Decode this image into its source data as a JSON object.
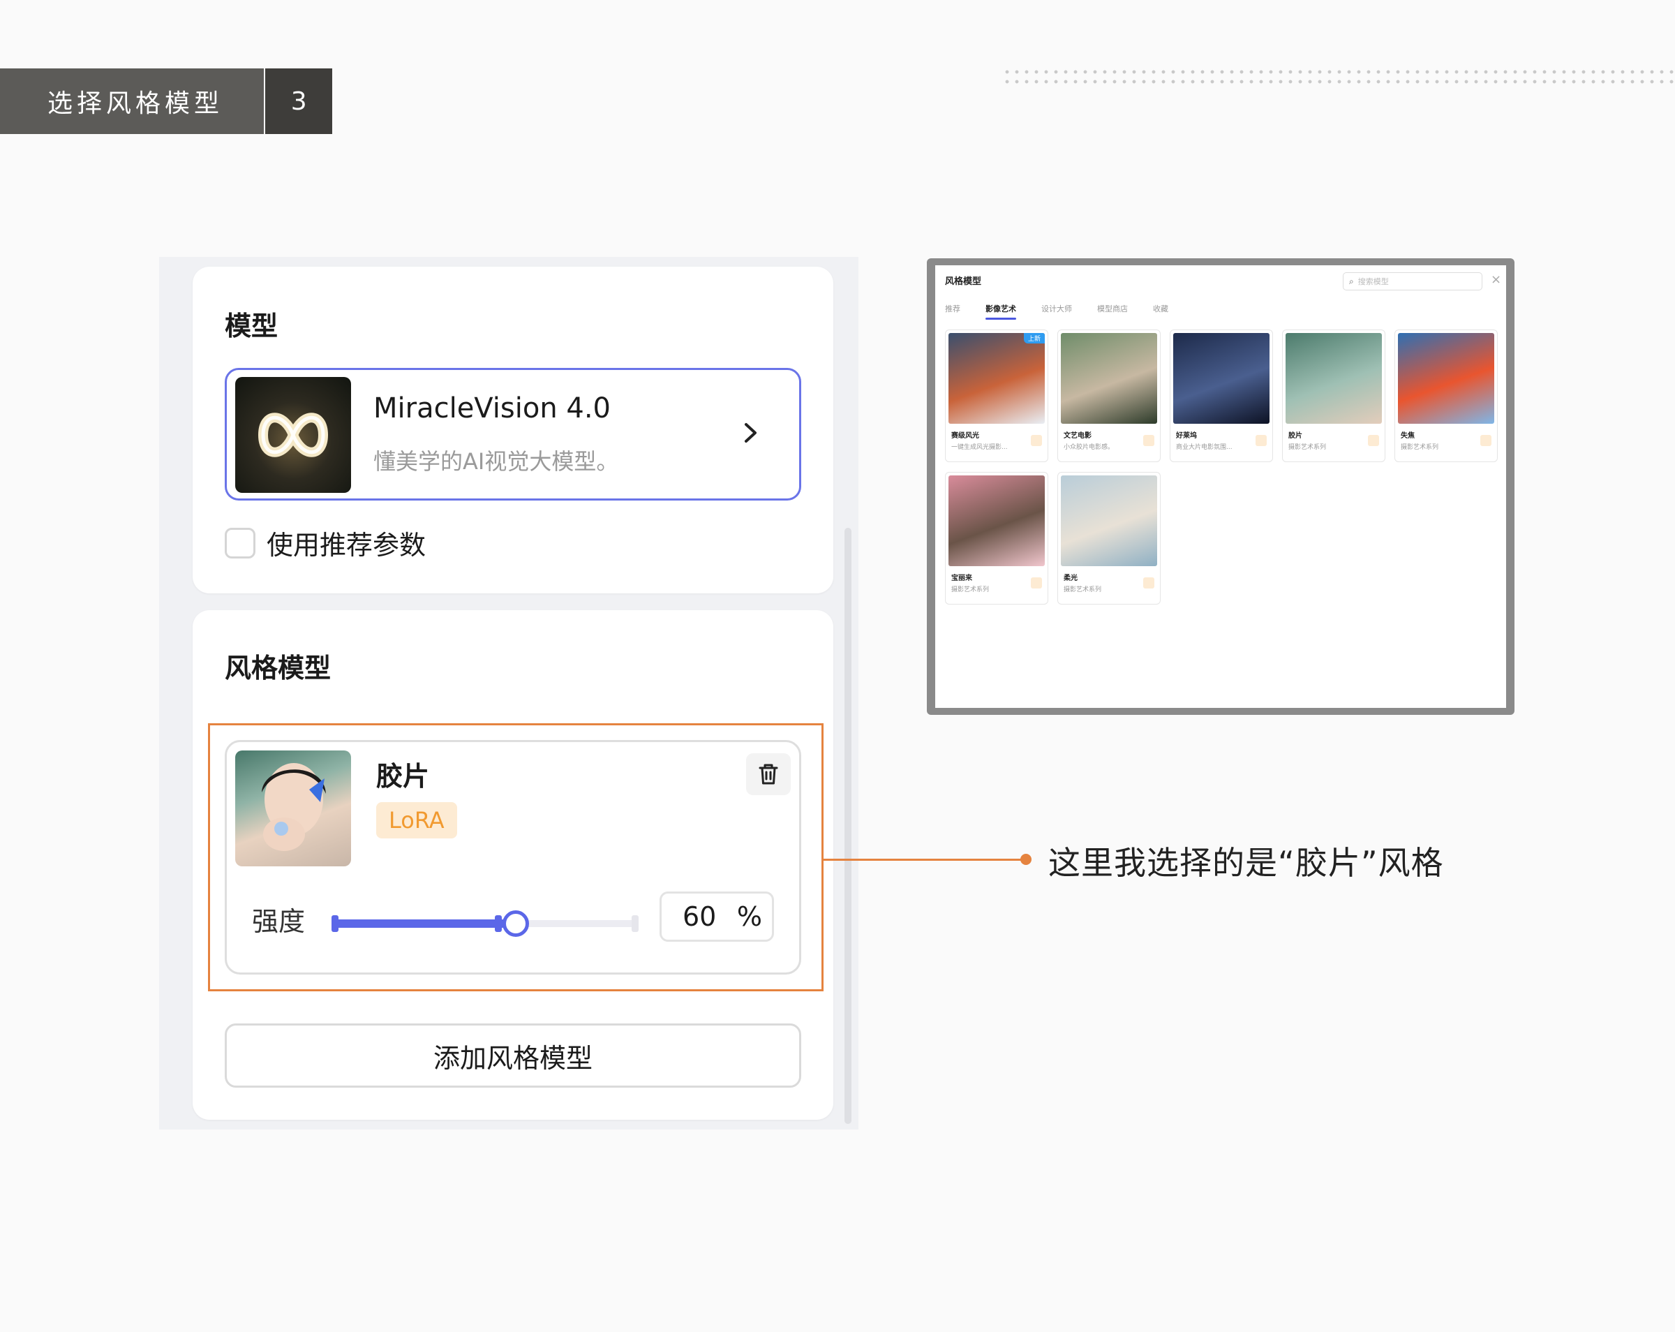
{
  "header": {
    "title": "选择风格模型",
    "step": "3"
  },
  "panel": {
    "model_section_title": "模型",
    "model": {
      "name": "MiracleVision 4.0",
      "description": "懂美学的AI视觉大模型。"
    },
    "use_recommended_label": "使用推荐参数",
    "use_recommended_checked": false,
    "style_section_title": "风格模型",
    "style_item": {
      "name": "胶片",
      "tag": "LoRA",
      "strength_label": "强度",
      "strength_value": "60",
      "strength_unit": "%",
      "strength_fraction": 0.6
    },
    "add_button_label": "添加风格模型"
  },
  "callout": {
    "text": "这里我选择的是“胶片”风格"
  },
  "screenshot": {
    "title": "风格模型",
    "search_placeholder": "搜索模型",
    "tabs": [
      {
        "label": "推荐",
        "active": false
      },
      {
        "label": "影像艺术",
        "active": true
      },
      {
        "label": "设计大师",
        "active": false
      },
      {
        "label": "模型商店",
        "active": false
      },
      {
        "label": "收藏",
        "active": false
      }
    ],
    "cards": [
      {
        "name": "赛级风光",
        "subtitle": "一键生成风光摄影...",
        "badge": "上新",
        "palette": [
          "#3a4f6e",
          "#c9633a",
          "#e9eef4"
        ]
      },
      {
        "name": "文艺电影",
        "subtitle": "小众胶片电影感。",
        "badge": "",
        "palette": [
          "#6f8d6a",
          "#c7b8a2",
          "#2d3b2a"
        ]
      },
      {
        "name": "好莱坞",
        "subtitle": "商业大片电影氛围...",
        "badge": "",
        "palette": [
          "#1d2a4a",
          "#4a5f8f",
          "#0d1224"
        ]
      },
      {
        "name": "胶片",
        "subtitle": "摄影艺术系列",
        "badge": "",
        "palette": [
          "#4c7b6c",
          "#9fc0b4",
          "#e3cdbb"
        ]
      },
      {
        "name": "失焦",
        "subtitle": "摄影艺术系列",
        "badge": "",
        "palette": [
          "#2e6fb3",
          "#e9552f",
          "#7fb6e8"
        ]
      },
      {
        "name": "宝丽来",
        "subtitle": "摄影艺术系列",
        "badge": "",
        "palette": [
          "#d98c9b",
          "#6a5448",
          "#f1c6cd"
        ]
      },
      {
        "name": "柔光",
        "subtitle": "摄影艺术系列",
        "badge": "",
        "palette": [
          "#b9cdd8",
          "#e8e1d6",
          "#8fb0c4"
        ]
      }
    ]
  },
  "colors": {
    "accent": "#5b67e8",
    "highlight": "#e5833f",
    "tag_text": "#f19a30"
  }
}
